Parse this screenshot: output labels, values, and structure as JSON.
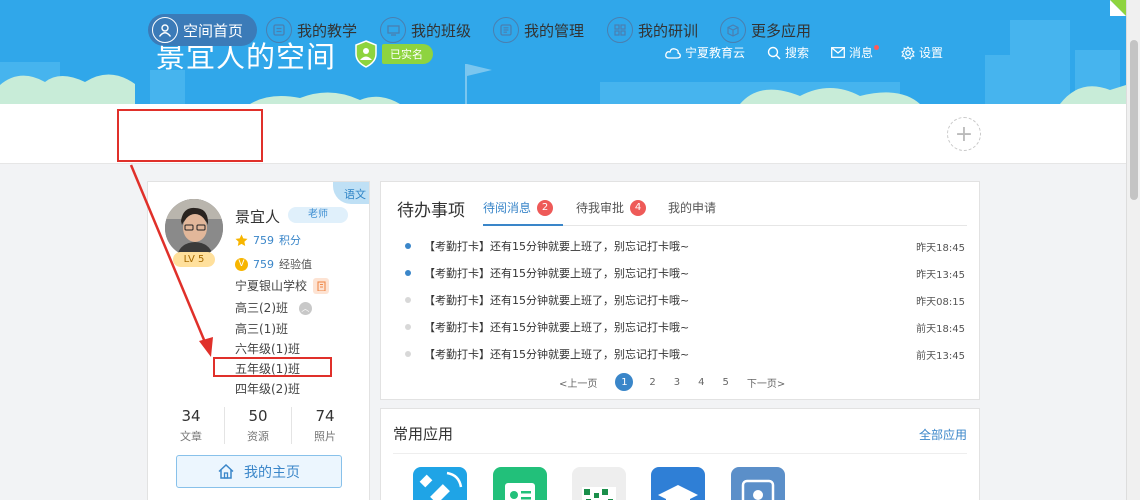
{
  "header": {
    "title": "景宜人的空间",
    "verified_label": "已实名",
    "links": [
      {
        "label": "宁夏教育云",
        "icon": "cloud-icon"
      },
      {
        "label": "搜索",
        "icon": "search-icon"
      },
      {
        "label": "消息",
        "icon": "mail-icon"
      },
      {
        "label": "设置",
        "icon": "gear-icon"
      }
    ]
  },
  "nav": {
    "items": [
      {
        "label": "空间首页",
        "icon": "user-icon",
        "active": true
      },
      {
        "label": "我的教学",
        "icon": "teaching-icon"
      },
      {
        "label": "我的班级",
        "icon": "class-icon"
      },
      {
        "label": "我的管理",
        "icon": "manage-icon"
      },
      {
        "label": "我的研训",
        "icon": "research-icon"
      },
      {
        "label": "更多应用",
        "icon": "cube-icon"
      }
    ],
    "plus_label": "+"
  },
  "profile": {
    "subject": "语文",
    "name": "景宜人",
    "role": "老师",
    "level": "LV 5",
    "points_value": "759",
    "points_label": "积分",
    "exp_value": "759",
    "exp_label": "经验值",
    "exp_badge": "V",
    "school": "宁夏银山学校",
    "classes": [
      "高三(2)班",
      "高三(1)班",
      "六年级(1)班",
      "五年级(1)班",
      "四年级(2)班"
    ],
    "counts": [
      {
        "num": "34",
        "label": "文章"
      },
      {
        "num": "50",
        "label": "资源"
      },
      {
        "num": "74",
        "label": "照片"
      }
    ],
    "home_button": "我的主页"
  },
  "todo": {
    "title": "待办事项",
    "tabs": [
      {
        "label": "待阅消息",
        "badge": "2",
        "active": true
      },
      {
        "label": "待我审批",
        "badge": "4"
      },
      {
        "label": "我的申请",
        "badge": ""
      }
    ],
    "messages": [
      {
        "text": "【考勤打卡】还有15分钟就要上班了，别忘记打卡哦~",
        "time": "昨天18:45",
        "unread": true
      },
      {
        "text": "【考勤打卡】还有15分钟就要上班了，别忘记打卡哦~",
        "time": "昨天13:45",
        "unread": true
      },
      {
        "text": "【考勤打卡】还有15分钟就要上班了，别忘记打卡哦~",
        "time": "昨天08:15",
        "unread": false
      },
      {
        "text": "【考勤打卡】还有15分钟就要上班了，别忘记打卡哦~",
        "time": "前天18:45",
        "unread": false
      },
      {
        "text": "【考勤打卡】还有15分钟就要上班了，别忘记打卡哦~",
        "time": "前天13:45",
        "unread": false
      }
    ],
    "pager": {
      "prev": "<上一页",
      "pages": [
        "1",
        "2",
        "3",
        "4",
        "5"
      ],
      "current": "1",
      "next": "下一页>"
    }
  },
  "apps": {
    "title": "常用应用",
    "all_link": "全部应用",
    "icons": [
      {
        "name": "satellite-app-icon",
        "color": "#1fa4e6"
      },
      {
        "name": "id-card-app-icon",
        "color": "#22c07a"
      },
      {
        "name": "qr-app-icon",
        "color": "#eeeeee"
      },
      {
        "name": "graduation-app-icon",
        "color": "#2f7fd6"
      },
      {
        "name": "people-app-icon",
        "color": "#5b8fc9"
      }
    ]
  },
  "colors": {
    "brand": "#30a7ea",
    "accent": "#3a86c9",
    "highlight": "#e0302a"
  }
}
